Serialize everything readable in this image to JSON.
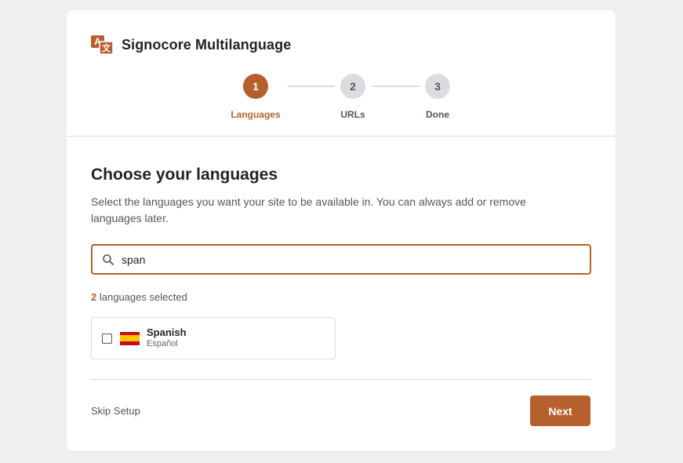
{
  "app": {
    "title": "Signocore Multilanguage"
  },
  "stepper": {
    "steps": [
      {
        "number": "1",
        "label": "Languages"
      },
      {
        "number": "2",
        "label": "URLs"
      },
      {
        "number": "3",
        "label": "Done"
      }
    ],
    "active_step": 1
  },
  "main": {
    "title": "Choose your languages",
    "description": "Select the languages you want your site to be available in. You can always add or remove languages later.",
    "search": {
      "value": "span",
      "icon": "search-icon"
    },
    "selected": {
      "count": "2",
      "suffix": "languages selected"
    },
    "languages": [
      {
        "name": "Spanish",
        "native": "Español",
        "flag": "spain-flag-icon",
        "checked": false
      }
    ]
  },
  "footer": {
    "skip_label": "Skip Setup",
    "next_label": "Next"
  },
  "colors": {
    "accent": "#b5602d",
    "background": "#f0f0f1",
    "border": "#dcdcde",
    "inactive_step": "#dcdcde"
  }
}
